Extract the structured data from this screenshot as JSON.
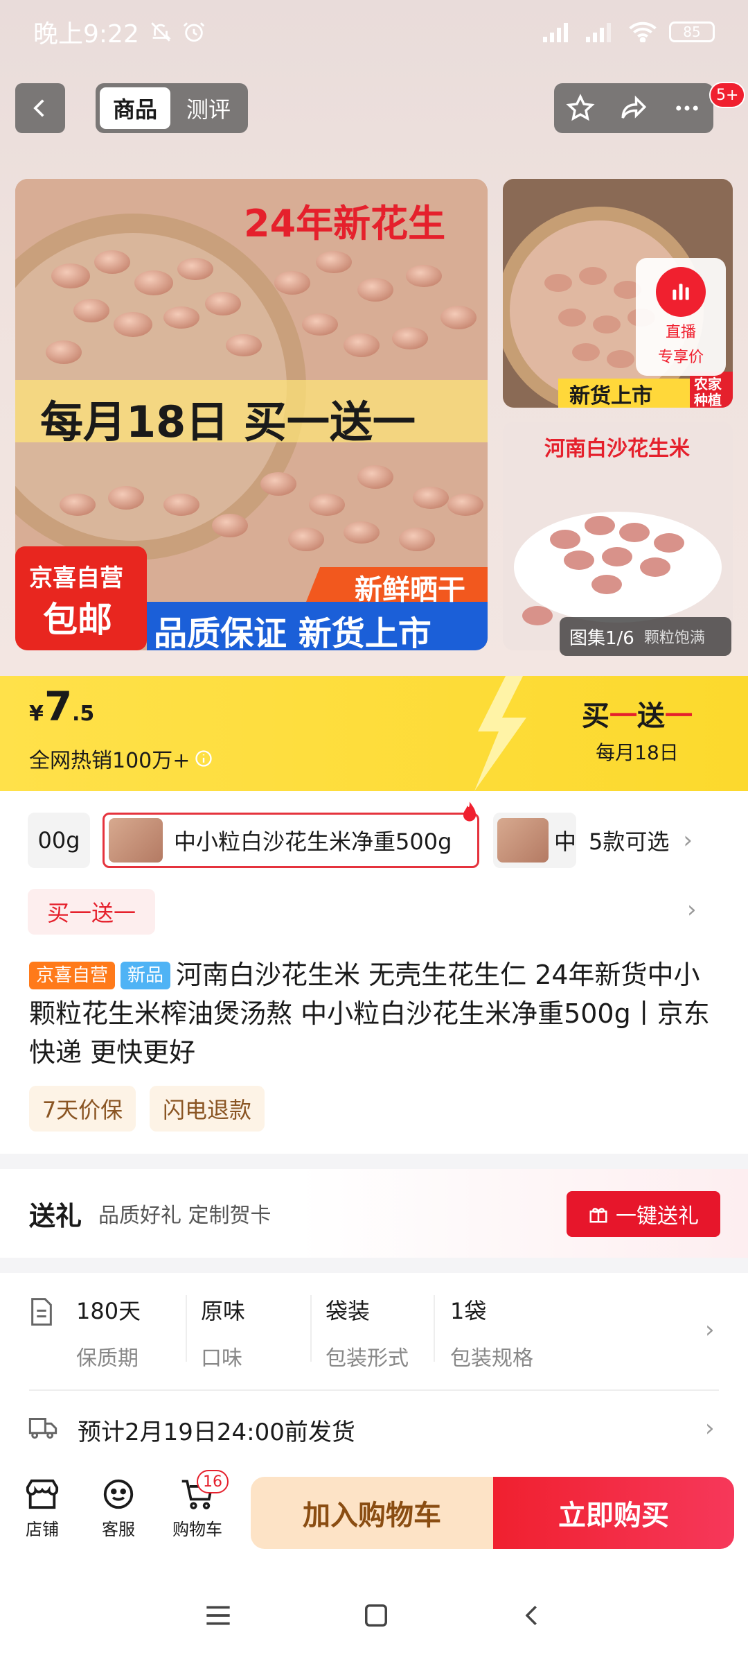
{
  "status_bar": {
    "time": "晚上9:22",
    "battery": "85",
    "signal": "HD"
  },
  "nav": {
    "tabs": [
      {
        "label": "商品",
        "active": true
      },
      {
        "label": "测评",
        "active": false
      }
    ],
    "badge": "5+"
  },
  "images": {
    "main_headline": "24年新花生",
    "main_offer": "每月18日 买一送一",
    "main_tag_1": "京喜自营",
    "main_tag_2": "包邮",
    "main_banner_fresh": "新鲜晒干",
    "main_banner_quality": "品质保证 新货上市",
    "side1_label": "新货上市",
    "side1_tag_1": "农家",
    "side1_tag_2": "种植",
    "side2_title": "河南白沙花生米",
    "live_label_1": "直播",
    "live_label_2": "专享价",
    "gallery_label": "图集1/6",
    "gallery_extra": "颗粒饱满"
  },
  "price": {
    "currency": "¥",
    "integer": "7",
    "decimal": ".5",
    "hot_sales": "全网热销100万+",
    "promo_title_prefix": "买",
    "promo_title_mid": "一",
    "promo_title_mid2": "送",
    "promo_title_suffix": "一",
    "promo_sub": "每月18日"
  },
  "sku": {
    "left_partial": "00g",
    "selected": "中小粒白沙花生米净重500g",
    "right_partial": "中",
    "count": "5款可选"
  },
  "promo_tag": "买一送一",
  "product": {
    "badge_self": "京喜自营",
    "badge_new": "新品",
    "title": "河南白沙花生米 无壳生花生仁 24年新货中小颗粒花生米榨油煲汤熬 中小粒白沙花生米净重500g丨京东快递 更快更好"
  },
  "services": [
    "7天价保",
    "闪电退款"
  ],
  "gift": {
    "title": "送礼",
    "subtitle": "品质好礼 定制贺卡",
    "button": "一键送礼"
  },
  "specs": [
    {
      "value": "180天",
      "label": "保质期"
    },
    {
      "value": "原味",
      "label": "口味"
    },
    {
      "value": "袋装",
      "label": "包装形式"
    },
    {
      "value": "1袋",
      "label": "包装规格"
    }
  ],
  "shipping": "预计2月19日24:00前发货",
  "bottom_bar": {
    "shop": "店铺",
    "service": "客服",
    "cart": "购物车",
    "cart_count": "16",
    "add_cart": "加入购物车",
    "buy_now": "立即购买"
  },
  "colors": {
    "accent_red": "#e7162b",
    "price_yellow": "#ffe14a",
    "cart_btn": "#fde3c6"
  }
}
